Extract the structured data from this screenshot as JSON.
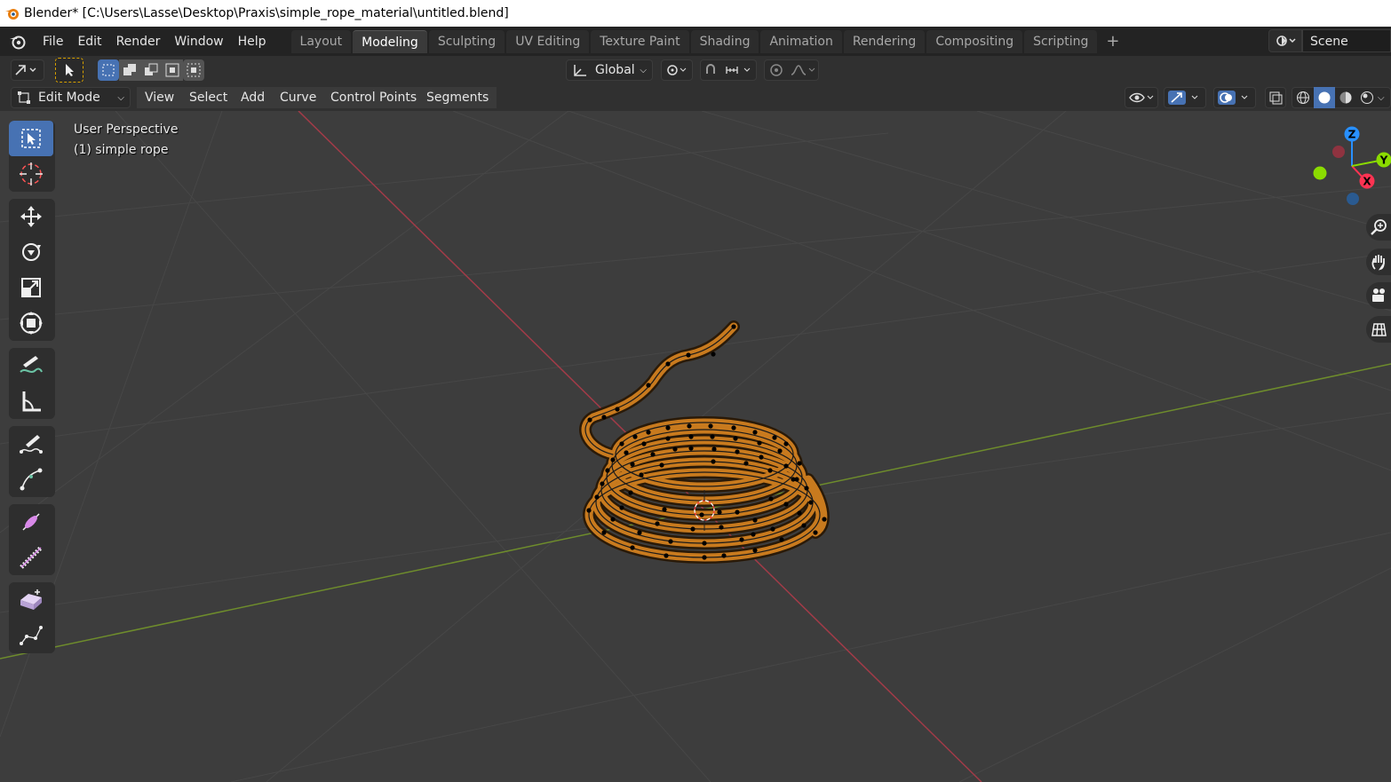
{
  "window": {
    "title": "Blender* [C:\\Users\\Lasse\\Desktop\\Praxis\\simple_rope_material\\untitled.blend]"
  },
  "menu": [
    "File",
    "Edit",
    "Render",
    "Window",
    "Help"
  ],
  "workspaces": [
    "Layout",
    "Modeling",
    "Sculpting",
    "UV Editing",
    "Texture Paint",
    "Shading",
    "Animation",
    "Rendering",
    "Compositing",
    "Scripting"
  ],
  "active_workspace": "Modeling",
  "scene": {
    "name": "Scene"
  },
  "tool_header": {
    "transform_orientation": "Global"
  },
  "viewport_header": {
    "mode": "Edit Mode",
    "menus": [
      "View",
      "Select",
      "Add",
      "Curve",
      "Control Points",
      "Segments"
    ]
  },
  "viewport": {
    "perspective_label": "User Perspective",
    "object_label": "(1) simple rope"
  },
  "gizmo": {
    "z_label": "Z",
    "y_label": "Y",
    "x_label": "X",
    "colors": {
      "x": "#ff3352",
      "y": "#8bdc00",
      "z": "#2890ff"
    }
  },
  "colors": {
    "rope": "#c87a1e",
    "accent": "#4772b3",
    "x_axis": "#a23b48",
    "y_axis": "#6e8c2c"
  }
}
